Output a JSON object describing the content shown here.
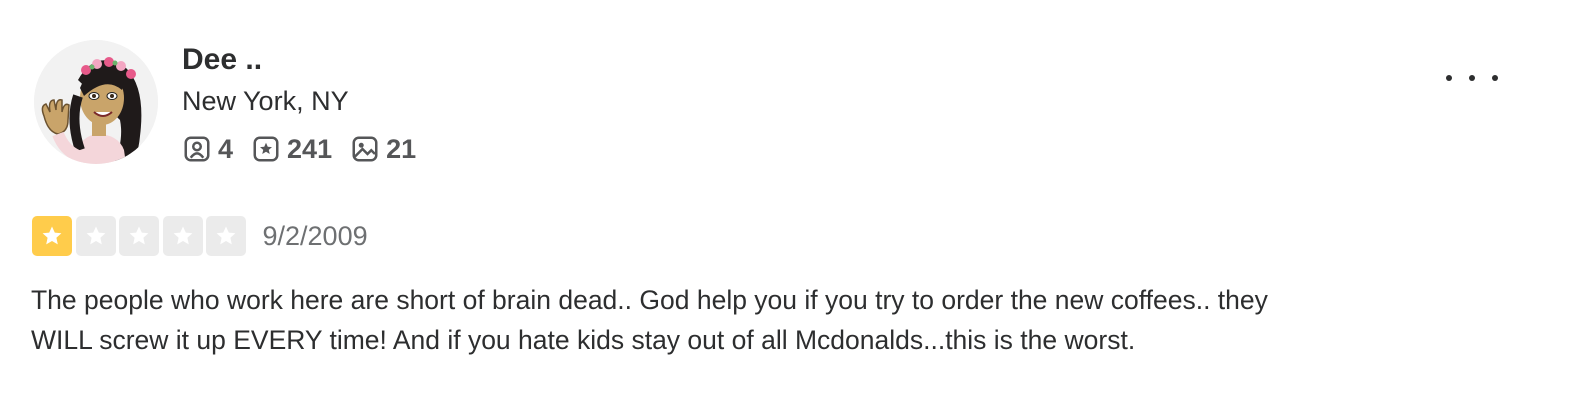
{
  "user": {
    "name": "Dee ..",
    "location": "New York, NY",
    "stats": [
      {
        "icon": "friends-icon",
        "value": "4"
      },
      {
        "icon": "review-star-icon",
        "value": "241"
      },
      {
        "icon": "photo-icon",
        "value": "21"
      }
    ]
  },
  "review": {
    "rating": 1,
    "max_rating": 5,
    "date": "9/2/2009",
    "text": "The people who work here are short of brain dead.. God help you if you try to order the new coffees.. they WILL screw it up EVERY time! And if you hate kids stay out of all Mcdonalds...this is the worst."
  },
  "colors": {
    "star_filled": "#ffcc4b",
    "star_empty": "#ebebeb",
    "text_primary": "#2d2e2f",
    "text_secondary": "#6e7072"
  },
  "icons": {
    "more": "more-options-icon"
  }
}
